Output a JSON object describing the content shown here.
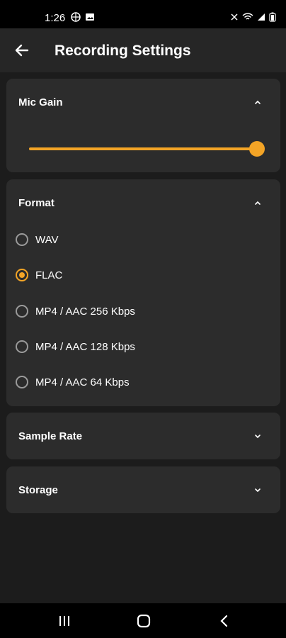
{
  "status": {
    "time": "1:26"
  },
  "app": {
    "title": "Recording Settings"
  },
  "mic_gain": {
    "title": "Mic Gain",
    "level": 1.0
  },
  "format": {
    "title": "Format",
    "options": [
      "WAV",
      "FLAC",
      "MP4 / AAC 256 Kbps",
      "MP4 / AAC 128 Kbps",
      "MP4 / AAC 64 Kbps"
    ],
    "selected": "FLAC"
  },
  "sample_rate": {
    "title": "Sample Rate"
  },
  "storage": {
    "title": "Storage"
  },
  "colors": {
    "accent": "#f3a426",
    "card": "#2c2c2c",
    "background": "#1c1c1c"
  },
  "icons": {
    "back": "arrow-left-icon",
    "collapse": "chevron-up-icon",
    "expand": "chevron-down-icon",
    "nav_recent": "recent-apps-icon",
    "nav_home": "home-icon",
    "nav_back": "nav-back-icon"
  }
}
